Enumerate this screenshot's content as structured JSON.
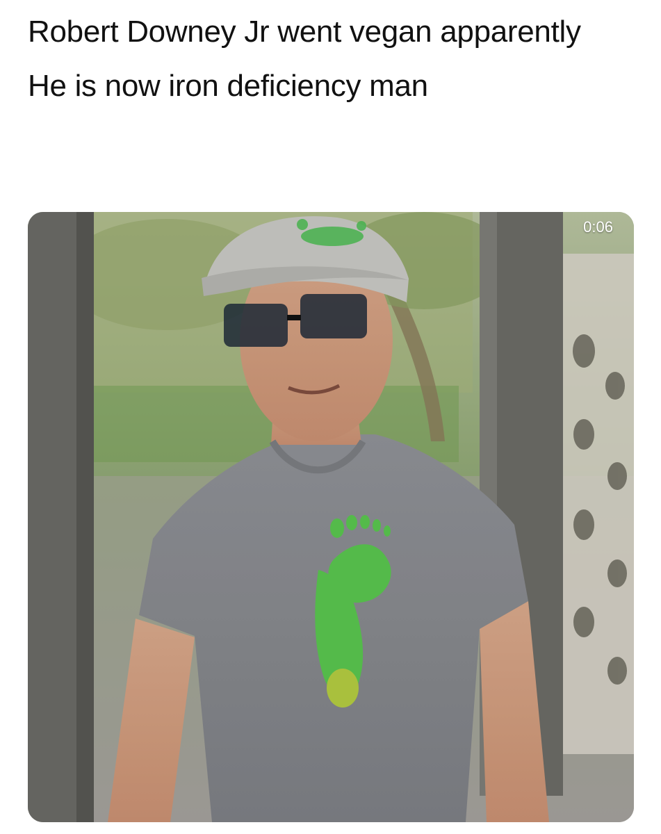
{
  "post": {
    "line1": "Robert Downey Jr went vegan apparently",
    "line2": "He is now iron deficiency man"
  },
  "video": {
    "timestamp": "0:06"
  }
}
